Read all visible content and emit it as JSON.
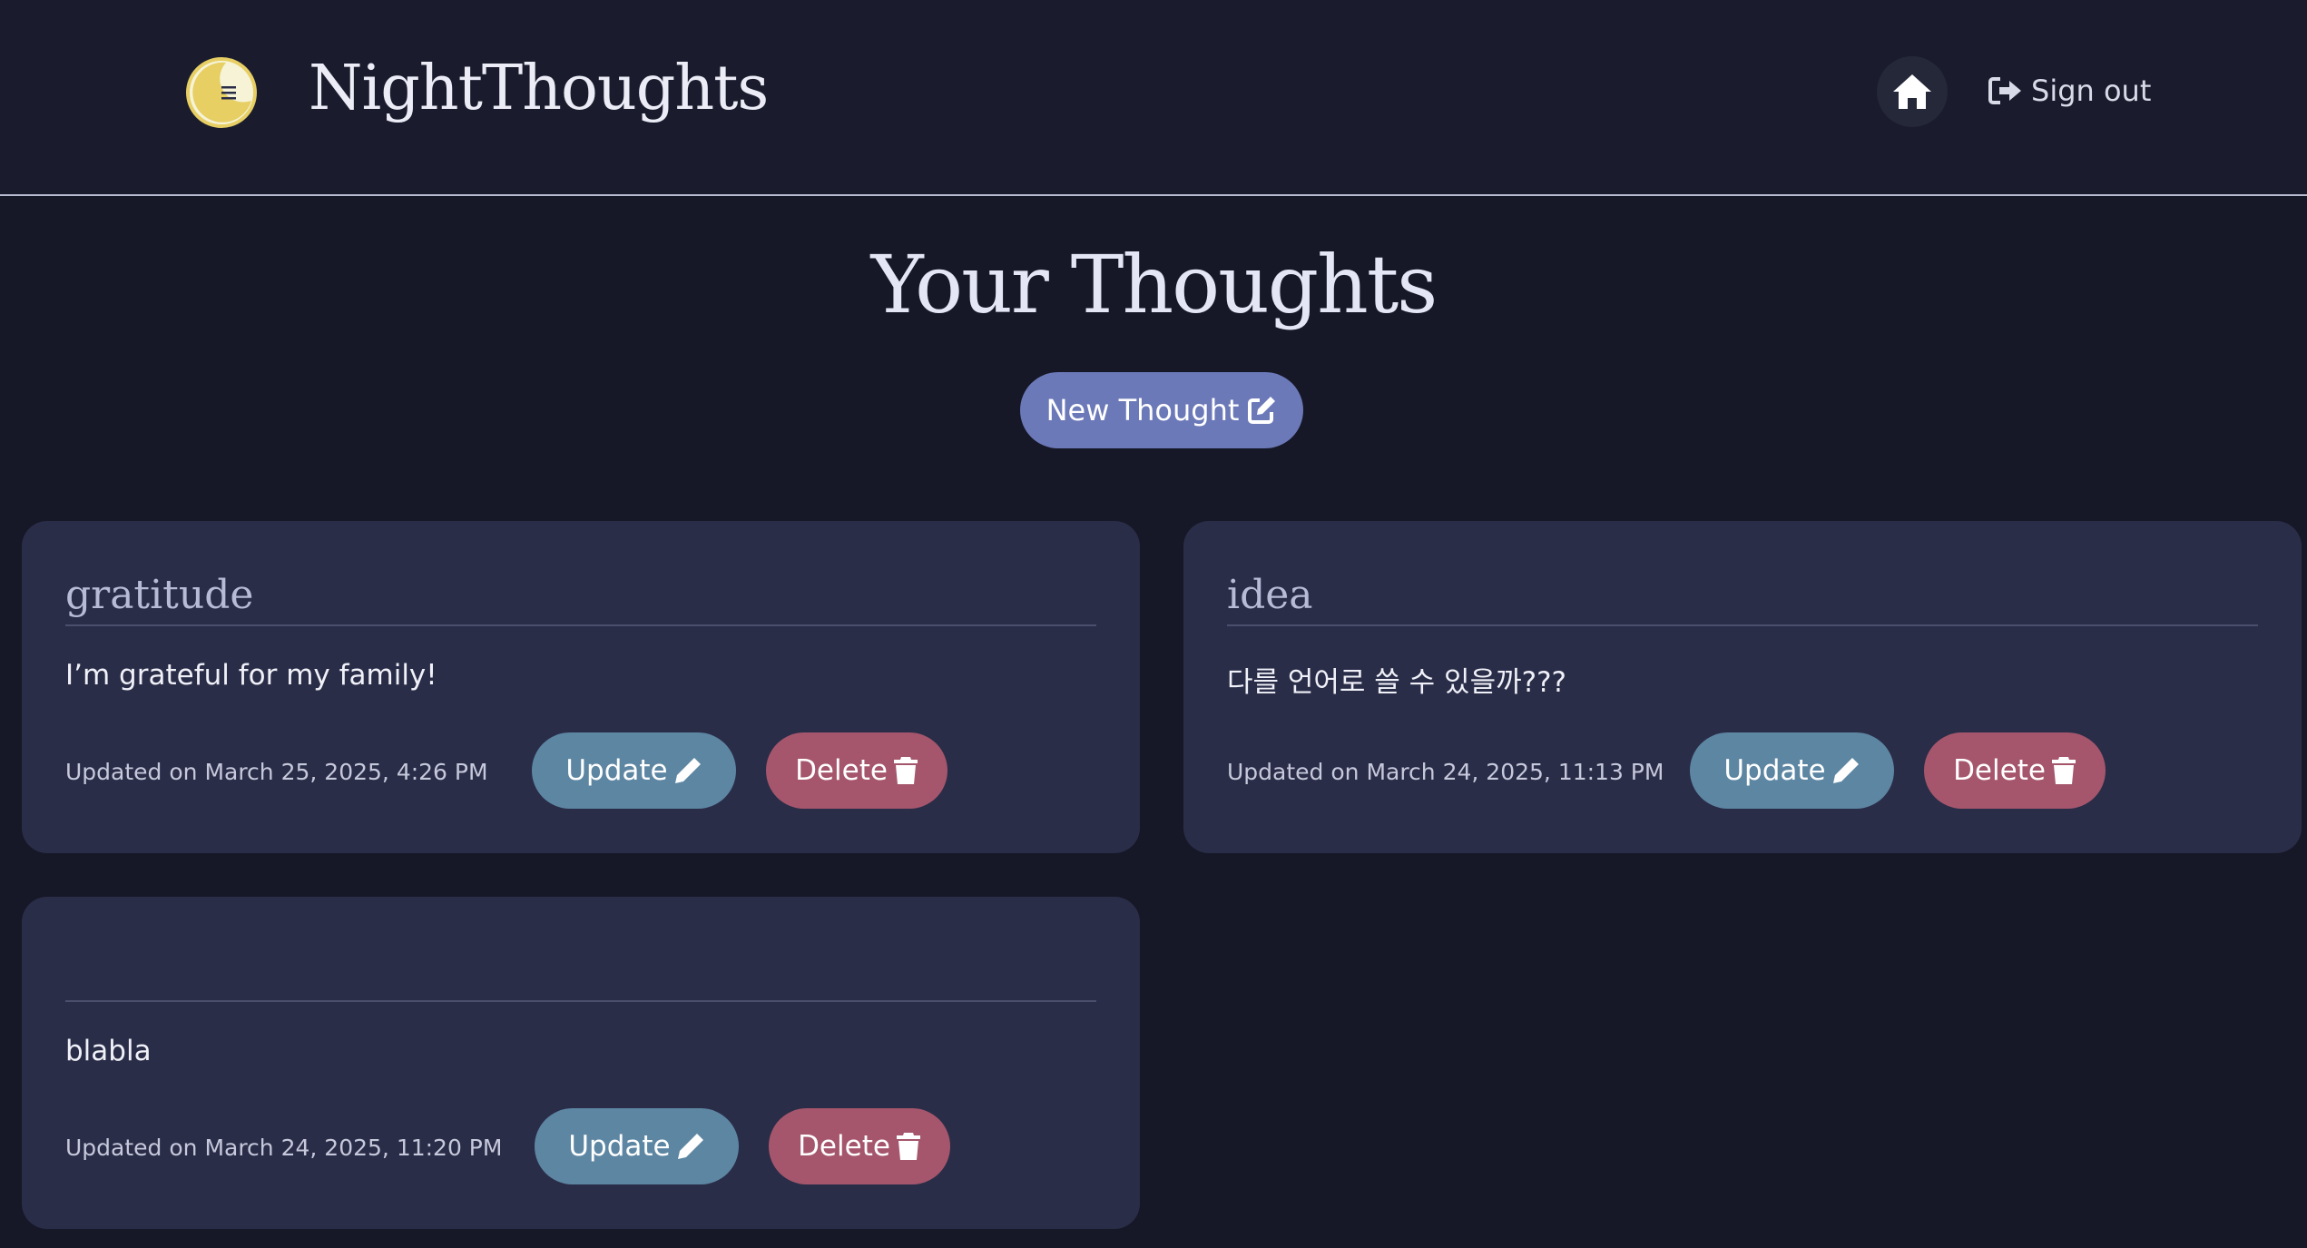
{
  "header": {
    "brand": "NightThoughts",
    "sign_out_label": "Sign out",
    "icons": {
      "logo": "moon-menu-icon",
      "home": "home-icon",
      "sign_out": "sign-out-icon"
    }
  },
  "main": {
    "title": "Your Thoughts",
    "new_thought_label": "New Thought",
    "thoughts": [
      {
        "title": "gratitude",
        "body": "I’m grateful for my family!",
        "updated": "Updated on March 25, 2025, 4:26 PM",
        "update_label": "Update",
        "delete_label": "Delete"
      },
      {
        "title": "idea",
        "body": "다를 언어로 쓸 수 있을까???",
        "updated": "Updated on March 24, 2025, 11:13 PM",
        "update_label": "Update",
        "delete_label": "Delete"
      },
      {
        "title": "",
        "body": "blabla",
        "updated": "Updated on March 24, 2025, 11:20 PM",
        "update_label": "Update",
        "delete_label": "Delete"
      }
    ]
  },
  "colors": {
    "background": "#161827",
    "header": "#1a1c2e",
    "card": "#2a2d48",
    "primary_button": "#6c79b8",
    "update_button": "#5d86a3",
    "delete_button": "#a5566c",
    "logo_moon": "#e7cf64"
  }
}
